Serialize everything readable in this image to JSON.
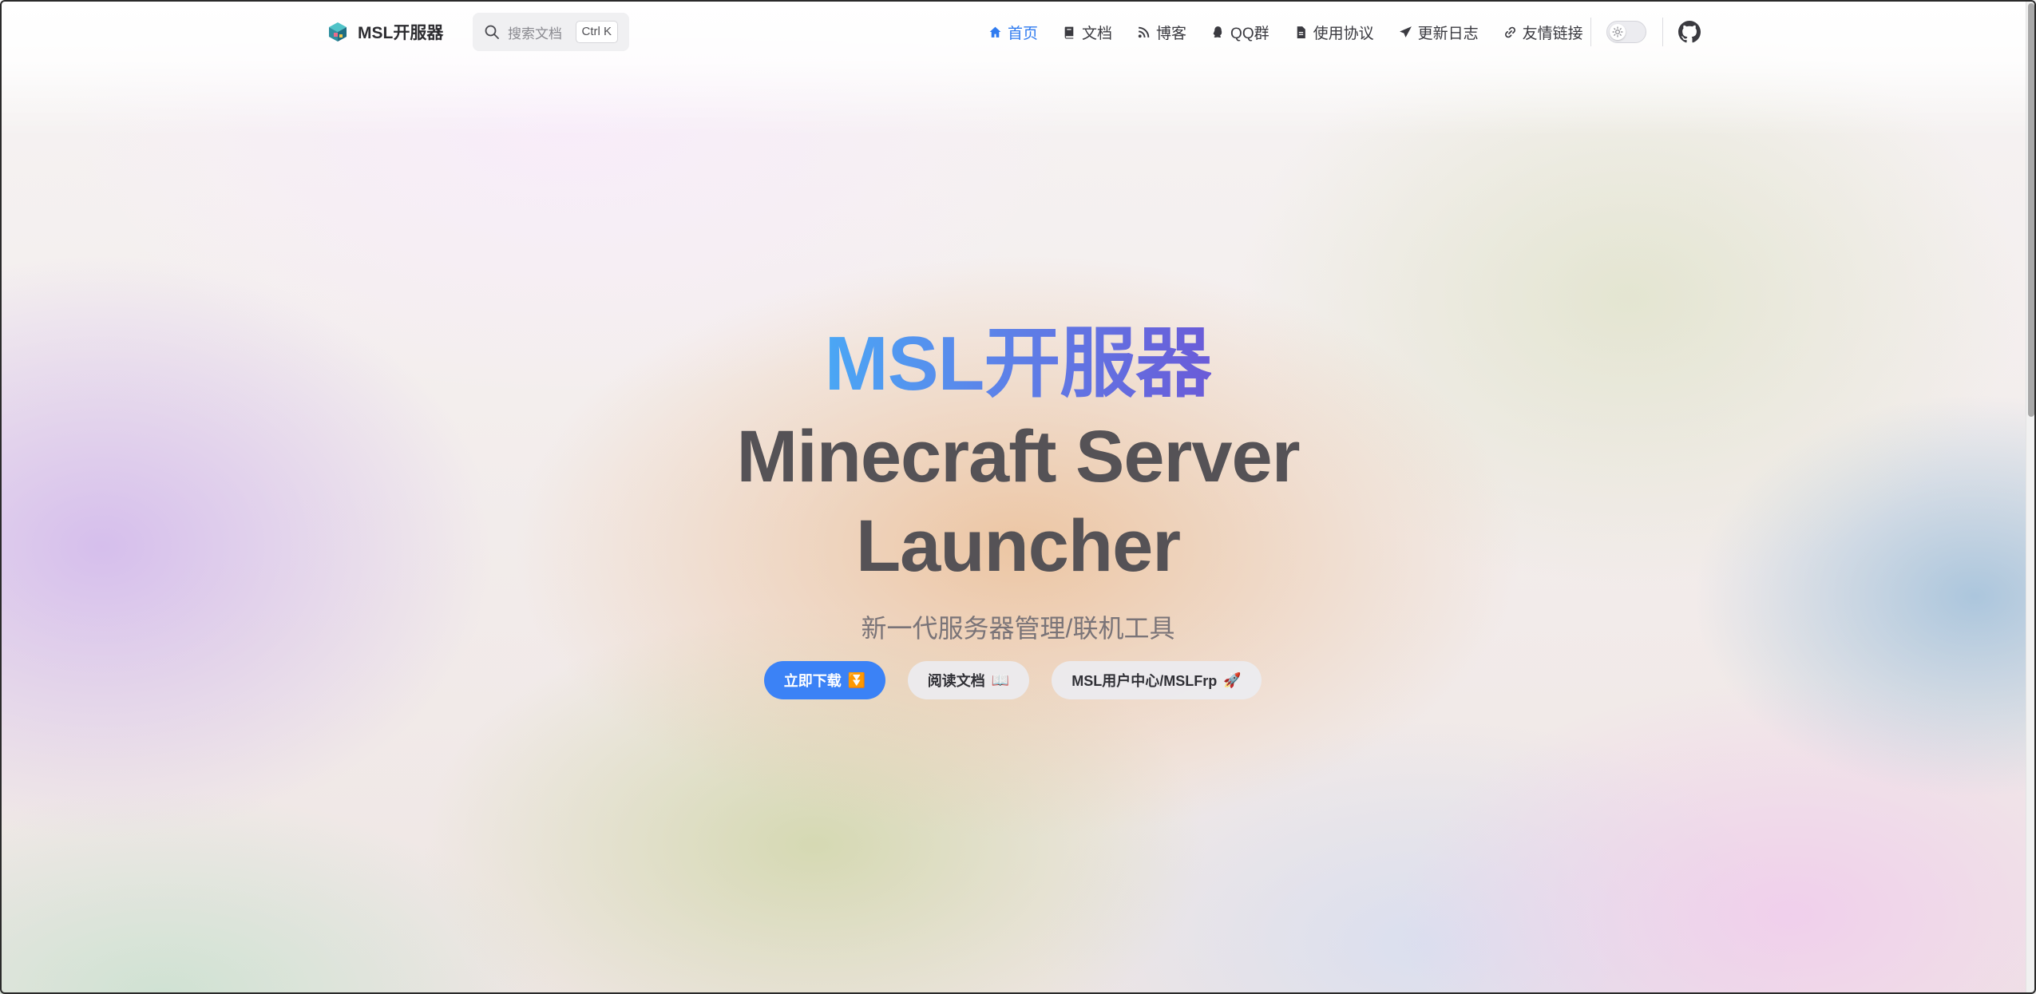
{
  "header": {
    "brand_name": "MSL开服器",
    "search": {
      "placeholder": "搜索文档",
      "shortcut": "Ctrl K"
    },
    "nav": [
      {
        "label": "首页",
        "icon": "home-icon",
        "active": true
      },
      {
        "label": "文档",
        "icon": "book-icon",
        "active": false
      },
      {
        "label": "博客",
        "icon": "blog-icon",
        "active": false
      },
      {
        "label": "QQ群",
        "icon": "qq-icon",
        "active": false
      },
      {
        "label": "使用协议",
        "icon": "file-icon",
        "active": false
      },
      {
        "label": "更新日志",
        "icon": "send-icon",
        "active": false
      },
      {
        "label": "友情链接",
        "icon": "link-icon",
        "active": false
      }
    ],
    "theme_toggle": {
      "icon": "sun-icon",
      "mode": "light"
    },
    "github": {
      "icon": "github-icon"
    }
  },
  "hero": {
    "name": "MSL开服器",
    "tagline_line1": "Minecraft Server",
    "tagline_line2": "Launcher",
    "subtitle": "新一代服务器管理/联机工具"
  },
  "actions": {
    "download": {
      "label": "立即下载",
      "emoji": "⏬"
    },
    "docs": {
      "label": "阅读文档",
      "emoji": "📖"
    },
    "user_center": {
      "label": "MSL用户中心/MSLFrp",
      "emoji": "🚀"
    }
  },
  "colors": {
    "accent": "#3b82f6",
    "active_nav": "#2f7bf0",
    "hero_gradient_start": "#4aa7f5",
    "hero_gradient_end": "#6a5bd8",
    "tagline": "#555256"
  }
}
